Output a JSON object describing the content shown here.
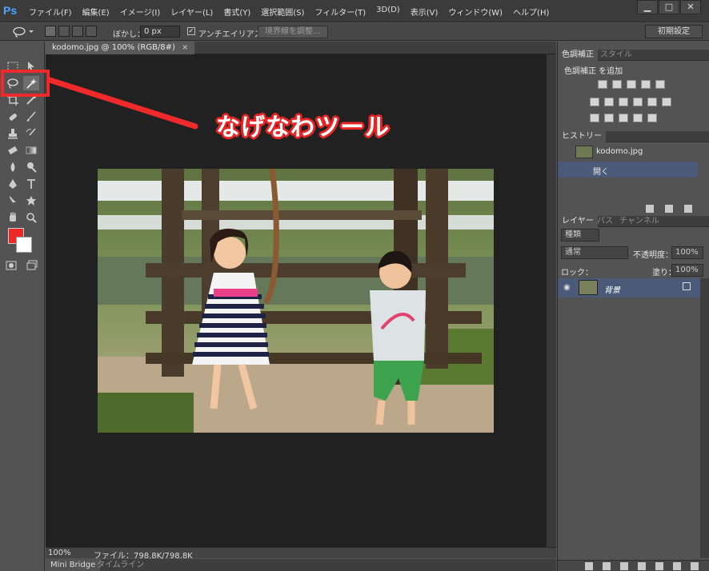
{
  "app": {
    "logo": "Ps"
  },
  "menu": [
    "ファイル(F)",
    "編集(E)",
    "イメージ(I)",
    "レイヤー(L)",
    "書式(Y)",
    "選択範囲(S)",
    "フィルター(T)",
    "3D(D)",
    "表示(V)",
    "ウィンドウ(W)",
    "ヘルプ(H)"
  ],
  "window_buttons": {
    "minimize": "▁",
    "restore": "□",
    "close": "✕"
  },
  "options": {
    "feather_label": "ぼかし：",
    "feather_value": "0 px",
    "antialias_label": "アンチエイリアス",
    "antialias_checked": "✓",
    "refine_edge_label": "境界線を調整...",
    "workspace_label": "初期設定"
  },
  "document": {
    "tab_title": "kodomo.jpg @ 100% (RGB/8#)",
    "tab_close": "×",
    "zoom": "100%",
    "file_info": "ファイル：798.8K/798.8K"
  },
  "bottom_tabs": [
    "Mini Bridge",
    "タイムライン"
  ],
  "annotation": {
    "label": "なげなわツール"
  },
  "colors": {
    "foreground": "#ee2828",
    "background": "#ffffff",
    "annotation": "#ee2a2a",
    "selection": "#4a5a78"
  },
  "panels": {
    "adjustments": {
      "tabs": [
        "色調補正",
        "スタイル"
      ],
      "title": "色調補正 を追加"
    },
    "history": {
      "tab": "ヒストリー",
      "snapshot": "kodomo.jpg",
      "step": "開く"
    },
    "layers": {
      "tabs": [
        "レイヤー",
        "パス",
        "チャンネル"
      ],
      "filter_label": "種類",
      "blend_mode": "通常",
      "opacity_label": "不透明度：",
      "opacity_value": "100%",
      "lock_label": "ロック：",
      "fill_label": "塗り：",
      "fill_value": "100%",
      "layer_name": "背景"
    }
  }
}
